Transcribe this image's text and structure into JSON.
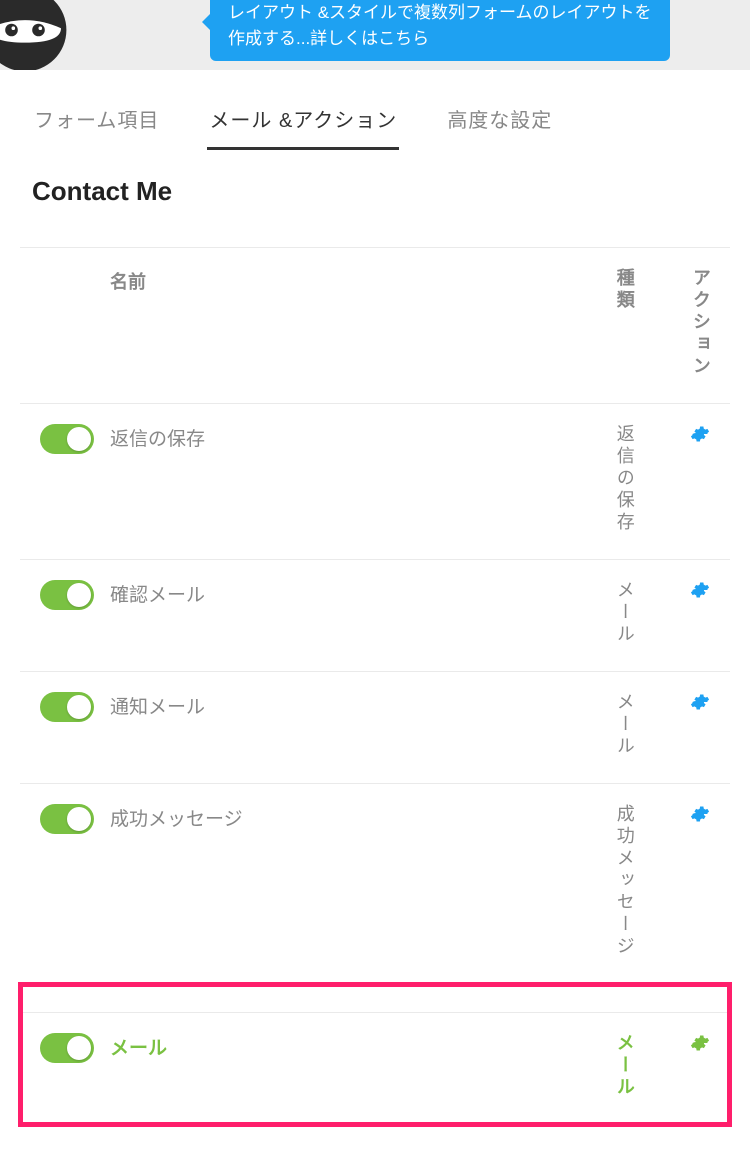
{
  "promo_text": "レイアウト &スタイルで複数列フォームのレイアウトを作成する...詳しくはこちら",
  "tabs": {
    "fields": "フォーム項目",
    "actions": "メール &アクション",
    "advanced": "高度な設定"
  },
  "form_title": "Contact Me",
  "headers": {
    "name": "名前",
    "type": "種類",
    "action": "アクション"
  },
  "actions_list": [
    {
      "name": "返信の保存",
      "type": "返信の保存",
      "enabled": true,
      "highlight": false
    },
    {
      "name": "確認メール",
      "type": "メール",
      "enabled": true,
      "highlight": false
    },
    {
      "name": "通知メール",
      "type": "メール",
      "enabled": true,
      "highlight": false
    },
    {
      "name": "成功メッセージ",
      "type": "成功メッセージ",
      "enabled": true,
      "highlight": false
    },
    {
      "name": "メール",
      "type": "メール",
      "enabled": true,
      "highlight": true
    }
  ]
}
